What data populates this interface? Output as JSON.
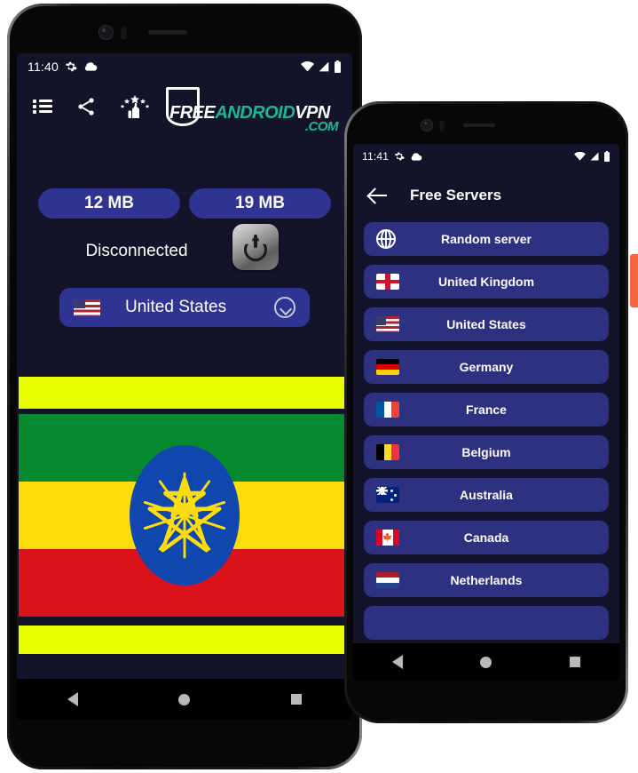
{
  "colors": {
    "app_background": "#131329",
    "pill_blue": "#2f3391",
    "list_item_blue": "#2d3180",
    "logo_teal": "#19b89a",
    "edge_accent": "#f4673f"
  },
  "phone1": {
    "status_bar": {
      "time": "11:40",
      "left_icons": [
        "gear-icon",
        "cloud-icon"
      ],
      "right_icons": [
        "wifi-icon",
        "signal-icon",
        "battery-icon"
      ]
    },
    "toolbar": {
      "icons": [
        "list-icon",
        "share-icon",
        "rate-stars-icon"
      ],
      "logo": {
        "part_free": "FREE",
        "part_android": "ANDROID",
        "part_vpn": "VPN",
        "part_com": ".COM"
      }
    },
    "stats": {
      "download_label": "12 MB",
      "upload_label": "19 MB"
    },
    "connection": {
      "status_text": "Disconnected",
      "power_button_name": "power-toggle"
    },
    "country_selector": {
      "flag": "us-flag",
      "country": "United States",
      "chevron": "chevron-down-icon"
    },
    "banner": {
      "name": "ethiopia-flag-banner",
      "top_stripe_color": "#e8ff00",
      "green": "#078930",
      "yellow": "#fcdd09",
      "red": "#da121a",
      "disc_color": "#0f47af",
      "star_color": "#fcdd09"
    },
    "nav_bar": [
      "back-button",
      "home-button",
      "recents-button"
    ]
  },
  "phone2": {
    "status_bar": {
      "time": "11:41",
      "left_icons": [
        "gear-icon",
        "cloud-icon"
      ],
      "right_icons": [
        "wifi-icon",
        "signal-icon",
        "battery-icon"
      ]
    },
    "app_bar": {
      "back_label": "back-arrow-icon",
      "title": "Free Servers"
    },
    "servers": [
      {
        "label": "Random server",
        "flag": "globe"
      },
      {
        "label": "United Kingdom",
        "flag": "uk"
      },
      {
        "label": "United States",
        "flag": "us"
      },
      {
        "label": "Germany",
        "flag": "de"
      },
      {
        "label": "France",
        "flag": "fr"
      },
      {
        "label": "Belgium",
        "flag": "be"
      },
      {
        "label": "Australia",
        "flag": "au"
      },
      {
        "label": "Canada",
        "flag": "ca"
      },
      {
        "label": "Netherlands",
        "flag": "nl"
      },
      {
        "label": "",
        "flag": ""
      }
    ],
    "nav_bar": [
      "back-button",
      "home-button",
      "recents-button"
    ]
  }
}
